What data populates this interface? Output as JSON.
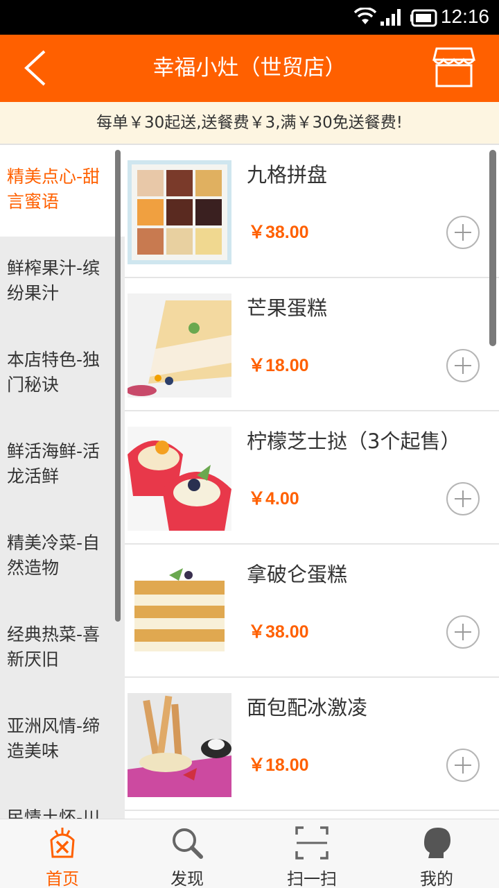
{
  "status_bar": {
    "time": "12:16"
  },
  "header": {
    "title": "幸福小灶（世贸店）"
  },
  "notice": {
    "text": "每单￥30起送,送餐费￥3,满￥30免送餐费!"
  },
  "categories": [
    {
      "label": "精美点心-甜言蜜语",
      "active": true
    },
    {
      "label": "鲜榨果汁-缤纷果汁"
    },
    {
      "label": "本店特色-独门秘诀"
    },
    {
      "label": "鲜活海鲜-活龙活鲜"
    },
    {
      "label": "精美冷菜-自然造物"
    },
    {
      "label": "经典热菜-喜新厌旧"
    },
    {
      "label": "亚洲风情-缔造美味"
    },
    {
      "label": "民情土怀-川"
    }
  ],
  "dishes": [
    {
      "name": "九格拼盘",
      "price": "￥38.00"
    },
    {
      "name": "芒果蛋糕",
      "price": "￥18.00"
    },
    {
      "name": "柠檬芝士挞（3个起售）",
      "price": "￥4.00"
    },
    {
      "name": "拿破仑蛋糕",
      "price": "￥38.00"
    },
    {
      "name": "面包配冰激凌",
      "price": "￥18.00"
    }
  ],
  "tabs": [
    {
      "label": "首页",
      "icon": "home-icon",
      "active": true
    },
    {
      "label": "发现",
      "icon": "search-icon"
    },
    {
      "label": "扫一扫",
      "icon": "scan-icon"
    },
    {
      "label": "我的",
      "icon": "profile-icon"
    }
  ],
  "colors": {
    "brand": "#ff6000",
    "notice_bg": "#fdf5e1",
    "sidebar_bg": "#ebebeb"
  }
}
